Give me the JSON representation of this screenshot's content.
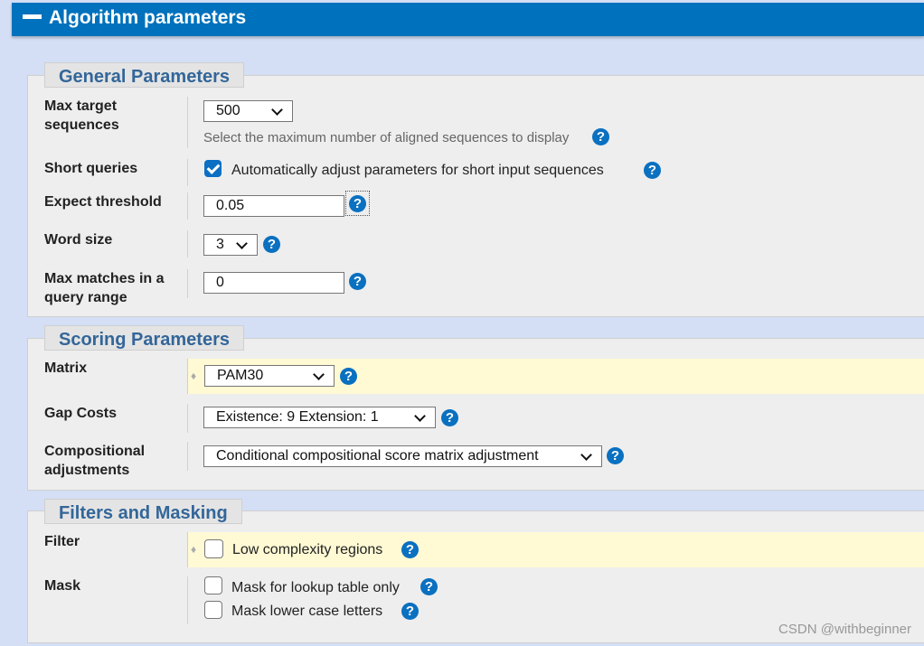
{
  "header": {
    "title": "Algorithm parameters",
    "collapse_icon": "minus-icon"
  },
  "general": {
    "legend": "General Parameters",
    "max_target": {
      "label": "Max target sequences",
      "value": "500",
      "hint": "Select the maximum number of aligned sequences to display"
    },
    "short_queries": {
      "label": "Short queries",
      "checked": true,
      "text": "Automatically adjust parameters for short input sequences"
    },
    "expect": {
      "label": "Expect threshold",
      "value": "0.05"
    },
    "word_size": {
      "label": "Word size",
      "value": "3"
    },
    "max_matches": {
      "label": "Max matches in a query range",
      "value": "0"
    }
  },
  "scoring": {
    "legend": "Scoring Parameters",
    "matrix": {
      "label": "Matrix",
      "value": "PAM30"
    },
    "gap": {
      "label": "Gap Costs",
      "value": "Existence: 9 Extension: 1"
    },
    "comp": {
      "label": "Compositional adjustments",
      "value": "Conditional compositional score matrix adjustment"
    }
  },
  "filters": {
    "legend": "Filters and Masking",
    "filter": {
      "label": "Filter",
      "text": "Low complexity regions",
      "checked": false
    },
    "mask": {
      "label": "Mask",
      "lookup": "Mask for lookup table only",
      "lower": "Mask lower case letters"
    }
  },
  "help_glyph": "?",
  "diamond": "♦",
  "watermark": "CSDN @withbeginner",
  "colors": {
    "header": "#0071bc",
    "legend_text": "#336699",
    "highlight": "#fff9d4",
    "help": "#0a70c0"
  }
}
